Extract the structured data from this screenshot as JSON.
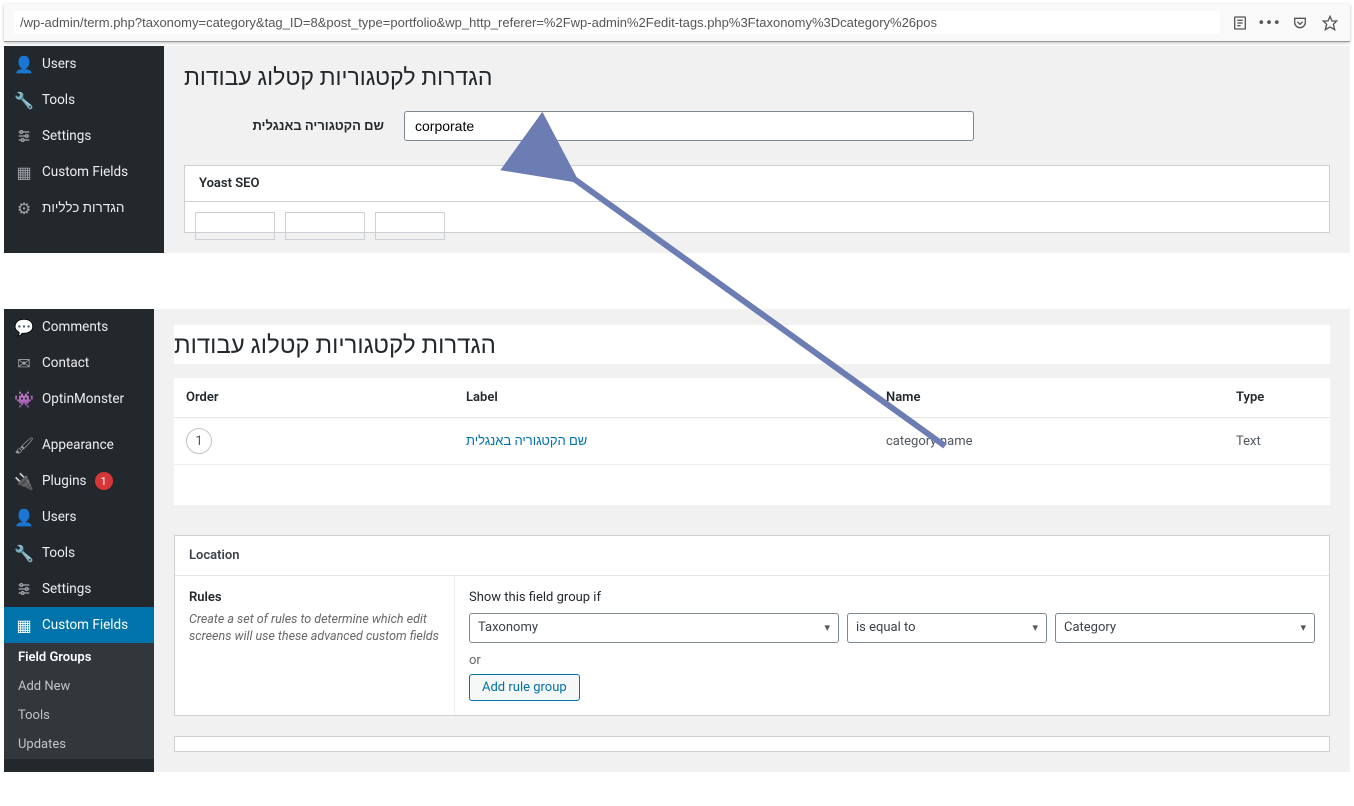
{
  "browser": {
    "url": "/wp-admin/term.php?taxonomy=category&tag_ID=8&post_type=portfolio&wp_http_referer=%2Fwp-admin%2Fedit-tags.php%3Ftaxonomy%3Dcategory%26pos"
  },
  "sidebar_top": {
    "items": [
      {
        "label": "Users",
        "icon": "person"
      },
      {
        "label": "Tools",
        "icon": "wrench"
      },
      {
        "label": "Settings",
        "icon": "sliders"
      },
      {
        "label": "Custom Fields",
        "icon": "grid"
      },
      {
        "label": "הגדרות כלליות",
        "icon": "gear"
      }
    ]
  },
  "sidebar_bottom": {
    "items": [
      {
        "label": "Comments",
        "icon": "comment"
      },
      {
        "label": "Contact",
        "icon": "mail"
      },
      {
        "label": "OptinMonster",
        "icon": "monster"
      },
      {
        "label": "Appearance",
        "icon": "brush"
      },
      {
        "label": "Plugins",
        "icon": "plug",
        "badge": "1"
      },
      {
        "label": "Users",
        "icon": "person"
      },
      {
        "label": "Tools",
        "icon": "wrench"
      },
      {
        "label": "Settings",
        "icon": "sliders"
      },
      {
        "label": "Custom Fields",
        "icon": "grid",
        "current": true
      }
    ],
    "subs": [
      {
        "label": "Field Groups",
        "current": true
      },
      {
        "label": "Add New"
      },
      {
        "label": "Tools"
      },
      {
        "label": "Updates"
      }
    ]
  },
  "segment1": {
    "title": "הגדרות לקטגוריות קטלוג עבודות",
    "field_label": "שם הקטגוריה באנגלית",
    "field_value": "corporate",
    "yoast_title": "Yoast SEO"
  },
  "segment2": {
    "title": "הגדרות לקטגוריות קטלוג עבודות",
    "table": {
      "headers": {
        "order": "Order",
        "label": "Label",
        "name": "Name",
        "type": "Type"
      },
      "row": {
        "order": "1",
        "label": "שם הקטגוריה באנגלית",
        "name": "category-name",
        "type": "Text"
      }
    },
    "location": {
      "title": "Location",
      "rules_title": "Rules",
      "rules_desc": "Create a set of rules to determine which edit screens will use these advanced custom fields",
      "show_if": "Show this field group if",
      "sel1": "Taxonomy",
      "sel2": "is equal to",
      "sel3": "Category",
      "or": "or",
      "add": "Add rule group"
    }
  }
}
